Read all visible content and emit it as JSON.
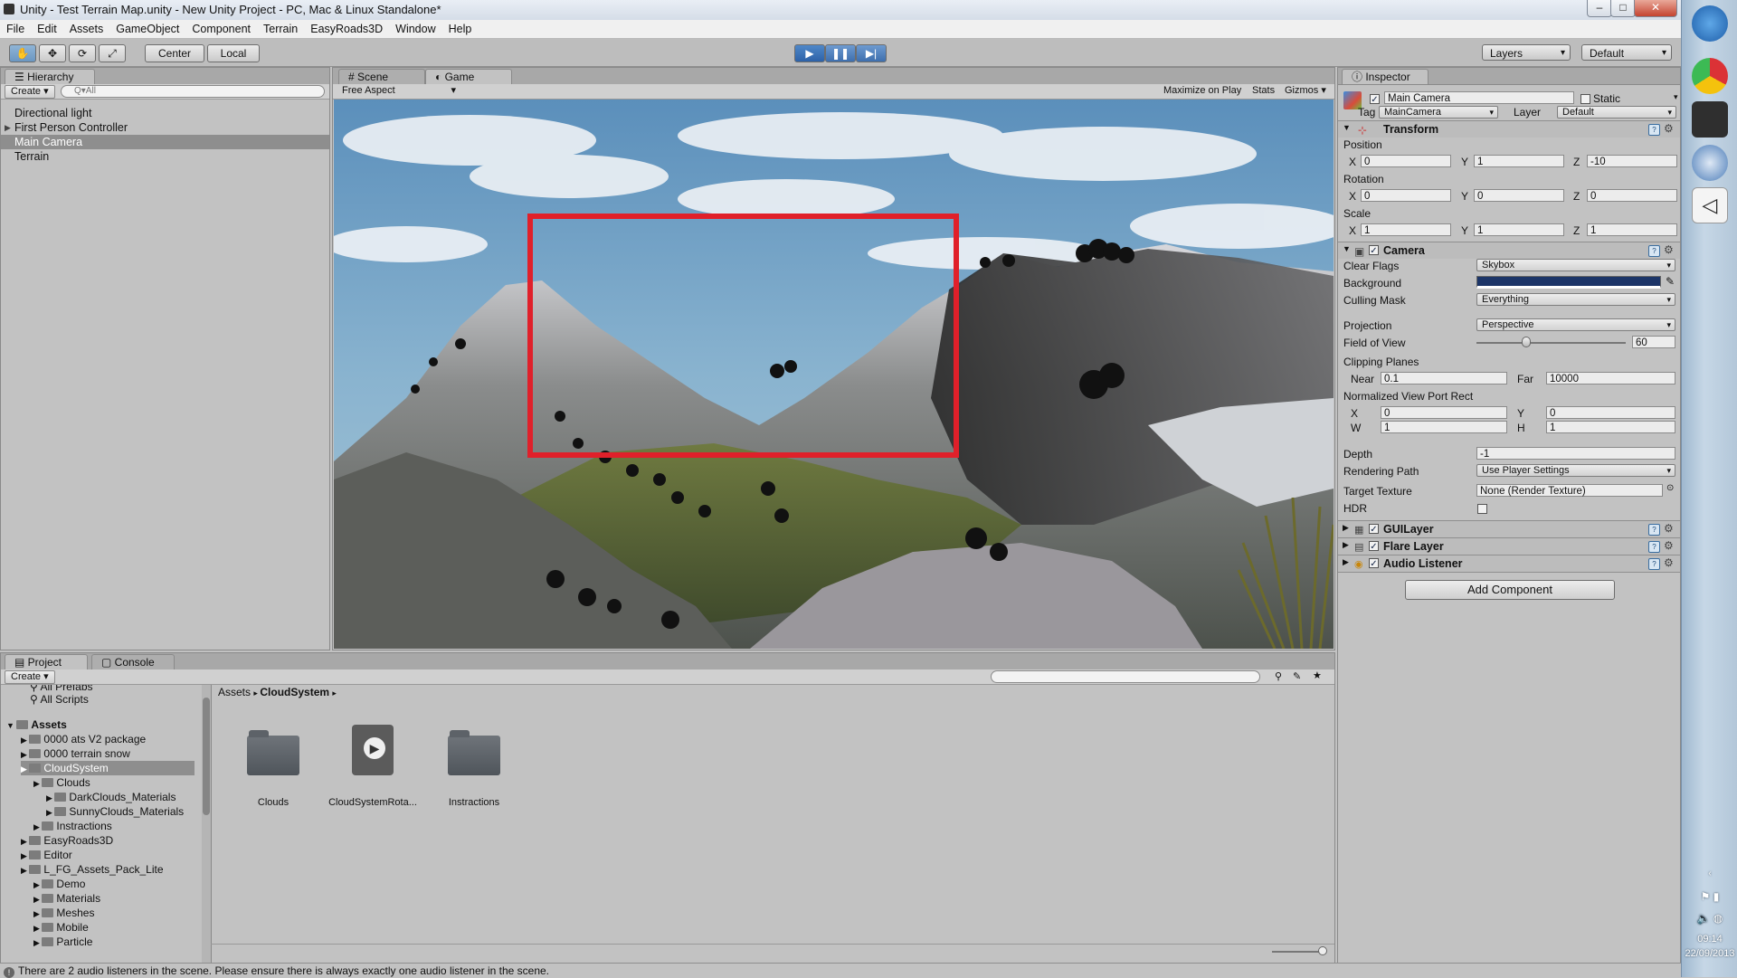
{
  "window": {
    "title": "Unity - Test Terrain Map.unity - New Unity Project - PC, Mac & Linux Standalone*",
    "min": "–",
    "max": "□",
    "close": "✕"
  },
  "menu": [
    "File",
    "Edit",
    "Assets",
    "GameObject",
    "Component",
    "Terrain",
    "EasyRoads3D",
    "Window",
    "Help"
  ],
  "toolbar": {
    "tools": [
      "✋",
      "✥",
      "⟳",
      "⤢"
    ],
    "center": "Center",
    "local": "Local",
    "play": "▶",
    "pause": "❚❚",
    "step": "▶|",
    "layers": "Layers",
    "layout": "Default"
  },
  "hierarchy": {
    "tab": "Hierarchy",
    "create": "Create",
    "search_placeholder": "Q▾All",
    "items": [
      "Directional light",
      "First Person Controller",
      "Main Camera",
      "Terrain"
    ]
  },
  "game": {
    "tabs": [
      "Scene",
      "Game"
    ],
    "aspect": "Free Aspect",
    "right_buttons": [
      "Maximize on Play",
      "Stats",
      "Gizmos"
    ]
  },
  "inspector": {
    "tab": "Inspector",
    "object_name": "Main Camera",
    "static_label": "Static",
    "tag_label": "Tag",
    "tag_value": "MainCamera",
    "layer_label": "Layer",
    "layer_value": "Default",
    "transform": {
      "title": "Transform",
      "position_label": "Position",
      "position": [
        "0",
        "1",
        "-10"
      ],
      "rotation_label": "Rotation",
      "rotation": [
        "0",
        "0",
        "0"
      ],
      "scale_label": "Scale",
      "scale": [
        "1",
        "1",
        "1"
      ],
      "axes": [
        "X",
        "Y",
        "Z"
      ]
    },
    "camera": {
      "title": "Camera",
      "clear_flags_label": "Clear Flags",
      "clear_flags": "Skybox",
      "background_label": "Background",
      "background_color": "#1c3568",
      "culling_mask_label": "Culling Mask",
      "culling_mask": "Everything",
      "projection_label": "Projection",
      "projection": "Perspective",
      "fov_label": "Field of View",
      "fov": "60",
      "clipping_label": "Clipping Planes",
      "near_label": "Near",
      "near": "0.1",
      "far_label": "Far",
      "far": "10000",
      "viewport_label": "Normalized View Port Rect",
      "vp_x_label": "X",
      "vp_x": "0",
      "vp_y_label": "Y",
      "vp_y": "0",
      "vp_w_label": "W",
      "vp_w": "1",
      "vp_h_label": "H",
      "vp_h": "1",
      "depth_label": "Depth",
      "depth": "-1",
      "rendering_path_label": "Rendering Path",
      "rendering_path": "Use Player Settings",
      "target_texture_label": "Target Texture",
      "target_texture": "None (Render Texture)",
      "hdr_label": "HDR"
    },
    "components": [
      "GUILayer",
      "Flare Layer",
      "Audio Listener"
    ],
    "add_component": "Add Component"
  },
  "project": {
    "tabs": [
      "Project",
      "Console"
    ],
    "create": "Create",
    "tree_top": [
      "All Prefabs",
      "All Scripts"
    ],
    "assets_label": "Assets",
    "tree": [
      {
        "label": "0000 ats V2 package",
        "depth": 1
      },
      {
        "label": "0000 terrain snow",
        "depth": 1
      },
      {
        "label": "CloudSystem",
        "depth": 1
      },
      {
        "label": "Clouds",
        "depth": 2
      },
      {
        "label": "DarkClouds_Materials",
        "depth": 3
      },
      {
        "label": "SunnyClouds_Materials",
        "depth": 3
      },
      {
        "label": "Instractions",
        "depth": 2
      },
      {
        "label": "EasyRoads3D",
        "depth": 1
      },
      {
        "label": "Editor",
        "depth": 1
      },
      {
        "label": "L_FG_Assets_Pack_Lite",
        "depth": 1
      },
      {
        "label": "Demo",
        "depth": 2
      },
      {
        "label": "Materials",
        "depth": 2
      },
      {
        "label": "Meshes",
        "depth": 2
      },
      {
        "label": "Mobile",
        "depth": 2
      },
      {
        "label": "Particle",
        "depth": 2
      }
    ],
    "breadcrumb": [
      "Assets",
      "CloudSystem"
    ],
    "assets": [
      "Clouds",
      "CloudSystemRota...",
      "Instractions"
    ]
  },
  "status": "There are 2 audio listeners in the scene. Please ensure there is always exactly one audio listener in the scene.",
  "taskbar": {
    "time": "09:14",
    "date": "22/09/2013"
  }
}
